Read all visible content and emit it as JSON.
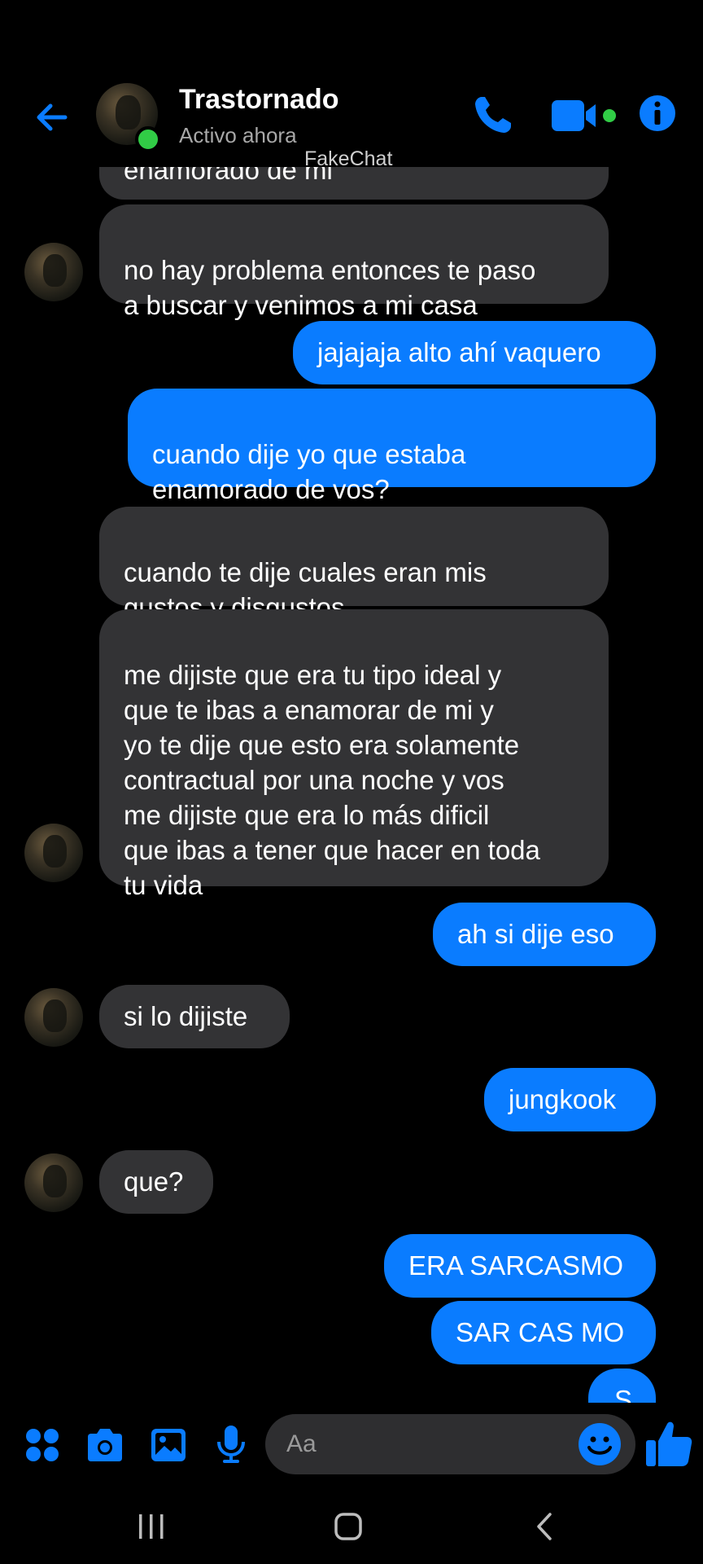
{
  "header": {
    "title": "Trastornado",
    "status": "Activo ahora",
    "watermark": "FakeChat"
  },
  "colors": {
    "accent": "#0a7cff",
    "incoming": "#333335",
    "online": "#31cc46",
    "background": "#000000"
  },
  "messages": {
    "m0": "enamorado de mi",
    "m1": "no hay problema entonces te paso\na buscar y venimos a mi casa",
    "m2": "jajajaja alto ahí vaquero",
    "m3": "cuando dije yo que estaba\nenamorado de vos?",
    "m4": "cuando te dije cuales eran mis\ngustos y disgustos",
    "m5": "me dijiste que era tu tipo ideal y\nque te ibas a enamorar de mi y\nyo te dije que esto era solamente\ncontractual por una noche y vos\nme dijiste que era lo más dificil\nque ibas a tener que hacer en toda\ntu vida",
    "m6": "ah si dije eso",
    "m7": "si lo dijiste",
    "m8": "jungkook",
    "m9": "que?",
    "m10": "ERA SARCASMO",
    "m11": "SAR CAS MO",
    "m12": "S"
  },
  "composer": {
    "placeholder": "Aa",
    "icons": [
      "apps-icon",
      "camera-icon",
      "gallery-icon",
      "microphone-icon",
      "emoji-icon",
      "like-icon"
    ]
  },
  "navbar": {
    "icons": [
      "recent-apps-icon",
      "home-icon",
      "back-icon"
    ]
  }
}
